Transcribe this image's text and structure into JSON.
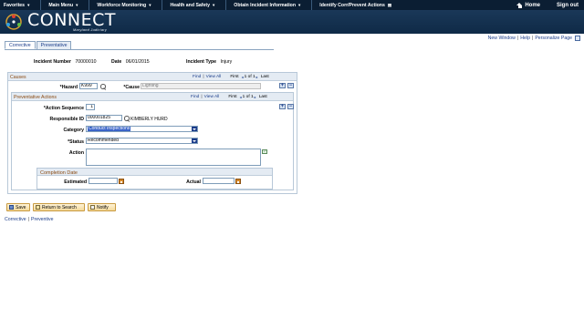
{
  "topnav": {
    "items": [
      {
        "label": "Favorites"
      },
      {
        "label": "Main Menu"
      },
      {
        "label": "Workforce Monitoring"
      },
      {
        "label": "Health and Safety"
      },
      {
        "label": "Obtain Incident Information"
      }
    ],
    "current": "Identify Corr/Prevent Actions",
    "home": "Home",
    "signout": "Sign out"
  },
  "banner": {
    "title": "CONNECT",
    "subtitle": "Maryland Judiciary"
  },
  "pagelinks": {
    "new_window": "New Window",
    "help": "Help",
    "personalize": "Personalize Page"
  },
  "tabs": [
    {
      "label": "Corrective",
      "active": true
    },
    {
      "label": "Preventative",
      "active": false
    }
  ],
  "header": {
    "incident_number_label": "Incident Number",
    "incident_number": "70000010",
    "date_label": "Date",
    "date": "06/01/2015",
    "incident_type_label": "Incident Type",
    "incident_type": "Injury"
  },
  "causes": {
    "title": "Causes",
    "find": "Find",
    "view_all": "View All",
    "first": "First",
    "count": "1 of 1",
    "last": "Last",
    "hazard_label": "*Hazard",
    "hazard_value": "K999",
    "cause_label": "*Cause",
    "cause_value": "Lighting"
  },
  "preventative_actions": {
    "title": "Preventative Actions",
    "find": "Find",
    "view_all": "View All",
    "first": "First",
    "count": "1 of 1",
    "last": "Last",
    "action_sequence_label": "*Action Sequence",
    "action_sequence": "1",
    "responsible_id_label": "Responsible ID",
    "responsible_id": "000001825",
    "responsible_name": "KIMBERLY HURD",
    "category_label": "Category",
    "category": "Conduct Inspections",
    "status_label": "*Status",
    "status": "Recommended",
    "action_label": "Action",
    "action": "",
    "completion_title": "Completion Date",
    "estimated_label": "Estimated",
    "estimated": "",
    "actual_label": "Actual",
    "actual": ""
  },
  "buttons": {
    "save": "Save",
    "return": "Return to Search",
    "notify": "Notify"
  },
  "bottom_links": {
    "corrective": "Corrective",
    "preventive": "Preventive"
  },
  "colors": {
    "nav": "#0b1e33",
    "banner": "#1a3858",
    "link": "#1a3c8a",
    "section_title": "#8a4a12",
    "button": "#f4d99a"
  }
}
